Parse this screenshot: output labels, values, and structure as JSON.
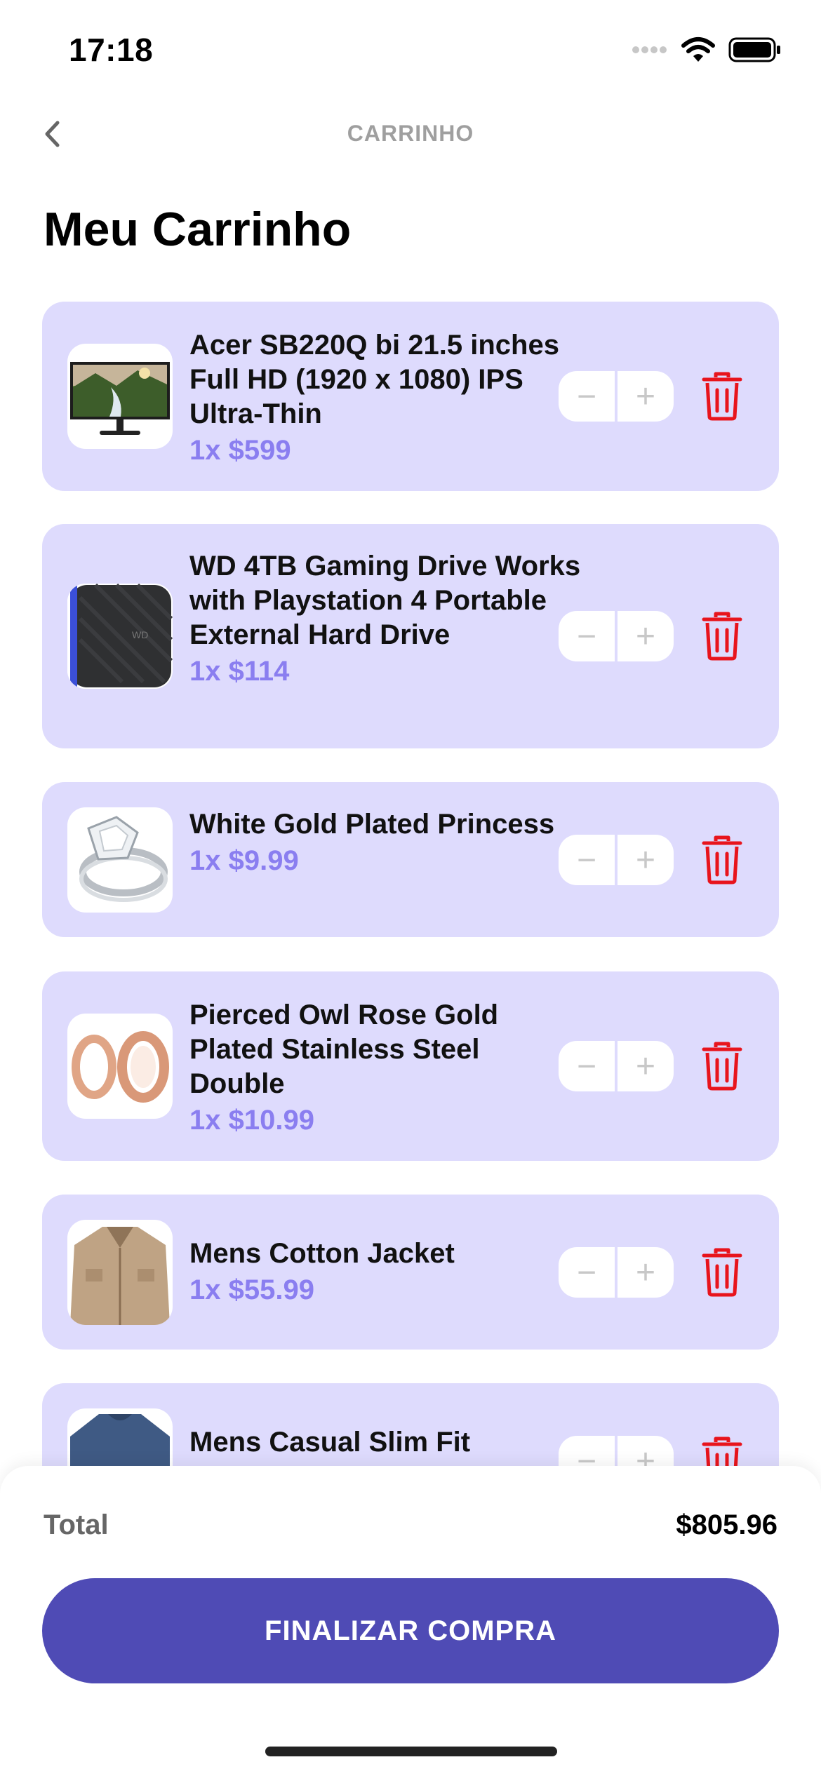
{
  "status_bar": {
    "time": "17:18"
  },
  "nav": {
    "title": "CARRINHO"
  },
  "page": {
    "title": "Meu Carrinho"
  },
  "qty_buttons": {
    "minus": "−",
    "plus": "+"
  },
  "cart_items": [
    {
      "name": "Acer SB220Q bi 21.5 inches Full HD (1920 x 1080) IPS Ultra-Thin",
      "price": "1x $599",
      "thumb": "monitor-image"
    },
    {
      "name": "WD 4TB Gaming Drive Works with Playstation 4 Portable External Hard Drive",
      "price": "1x $114",
      "thumb": "hard-drive-image"
    },
    {
      "name": "White Gold Plated Princess",
      "price": "1x $9.99",
      "thumb": "ring-image"
    },
    {
      "name": "Pierced Owl Rose Gold Plated Stainless Steel Double",
      "price": "1x $10.99",
      "thumb": "rose-gold-rings-image"
    },
    {
      "name": "Mens Cotton Jacket",
      "price": "1x $55.99",
      "thumb": "jacket-image"
    },
    {
      "name": "Mens Casual Slim Fit",
      "price": "",
      "thumb": "shirt-image"
    }
  ],
  "footer": {
    "total_label": "Total",
    "total_value": "$805.96",
    "checkout_label": "FINALIZAR COMPRA"
  },
  "colors": {
    "card_bg": "#dedbfd",
    "price": "#8a7ef0",
    "trash": "#e8141c",
    "checkout_bg": "#4f4bb5"
  }
}
